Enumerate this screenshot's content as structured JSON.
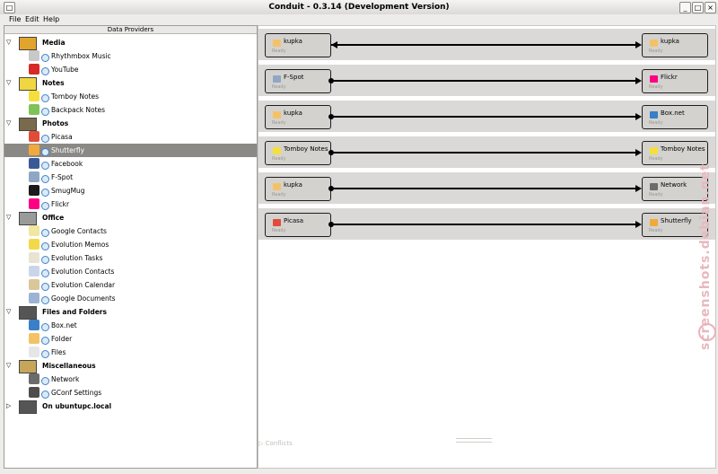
{
  "window": {
    "title": "Conduit - 0.3.14 (Development Version)"
  },
  "menu": [
    "File",
    "Edit",
    "Help"
  ],
  "left_panel": {
    "header": "Data Providers",
    "items": [
      {
        "kind": "category",
        "label": "Media",
        "icon": "media-icon",
        "color": "#e2a52b",
        "expanded": true
      },
      {
        "kind": "provider",
        "label": "Rhythmbox Music",
        "icon": "rhythmbox-icon",
        "color": "#c8c8c8"
      },
      {
        "kind": "provider",
        "label": "YouTube",
        "icon": "youtube-icon",
        "color": "#d72a25"
      },
      {
        "kind": "category",
        "label": "Notes",
        "icon": "notes-icon",
        "color": "#f0d640",
        "expanded": true
      },
      {
        "kind": "provider",
        "label": "Tomboy Notes",
        "icon": "tomboy-icon",
        "color": "#f5df3c"
      },
      {
        "kind": "provider",
        "label": "Backpack Notes",
        "icon": "backpack-icon",
        "color": "#7ec356"
      },
      {
        "kind": "category",
        "label": "Photos",
        "icon": "photos-icon",
        "color": "#7a6a4d",
        "expanded": true
      },
      {
        "kind": "provider",
        "label": "Picasa",
        "icon": "picasa-icon",
        "color": "#e14c3a"
      },
      {
        "kind": "provider",
        "label": "Shutterfly",
        "icon": "shutterfly-icon",
        "color": "#f2a93b",
        "selected": true
      },
      {
        "kind": "provider",
        "label": "Facebook",
        "icon": "facebook-icon",
        "color": "#3b5998"
      },
      {
        "kind": "provider",
        "label": "F-Spot",
        "icon": "fspot-icon",
        "color": "#8fa7c4"
      },
      {
        "kind": "provider",
        "label": "SmugMug",
        "icon": "smugmug-icon",
        "color": "#1a1a1a"
      },
      {
        "kind": "provider",
        "label": "Flickr",
        "icon": "flickr-icon",
        "color": "#ff0084"
      },
      {
        "kind": "category",
        "label": "Office",
        "icon": "office-icon",
        "color": "#9a9a9a",
        "expanded": true
      },
      {
        "kind": "provider",
        "label": "Google Contacts",
        "icon": "google-contacts-icon",
        "color": "#f1e6a2"
      },
      {
        "kind": "provider",
        "label": "Evolution Memos",
        "icon": "evolution-memos-icon",
        "color": "#f3d94a"
      },
      {
        "kind": "provider",
        "label": "Evolution Tasks",
        "icon": "evolution-tasks-icon",
        "color": "#e9e4d2"
      },
      {
        "kind": "provider",
        "label": "Evolution Contacts",
        "icon": "evolution-contacts-icon",
        "color": "#c9d6ea"
      },
      {
        "kind": "provider",
        "label": "Evolution Calendar",
        "icon": "evolution-calendar-icon",
        "color": "#d9c79a"
      },
      {
        "kind": "provider",
        "label": "Google Documents",
        "icon": "google-documents-icon",
        "color": "#9cb3d3"
      },
      {
        "kind": "category",
        "label": "Files and Folders",
        "icon": "computer-icon",
        "color": "#555555",
        "expanded": true
      },
      {
        "kind": "provider",
        "label": "Box.net",
        "icon": "boxnet-icon",
        "color": "#3a7fc7"
      },
      {
        "kind": "provider",
        "label": "Folder",
        "icon": "folder-icon",
        "color": "#f4c266"
      },
      {
        "kind": "provider",
        "label": "Files",
        "icon": "files-icon",
        "color": "#e6e6e6"
      },
      {
        "kind": "category",
        "label": "Miscellaneous",
        "icon": "misc-icon",
        "color": "#c7a65a",
        "expanded": true
      },
      {
        "kind": "provider",
        "label": "Network",
        "icon": "network-icon",
        "color": "#6b6b6b"
      },
      {
        "kind": "provider",
        "label": "GConf Settings",
        "icon": "gconf-icon",
        "color": "#4d4d4d"
      },
      {
        "kind": "category",
        "label": "On ubuntupc.local",
        "icon": "computer-icon",
        "color": "#555555",
        "expanded": false
      }
    ]
  },
  "canvas": {
    "conduits": [
      {
        "source": {
          "label": "kupka",
          "icon": "folder-icon",
          "color": "#f4c266",
          "status": "Ready"
        },
        "target": {
          "label": "kupka",
          "icon": "folder-icon",
          "color": "#f4c266",
          "status": "Ready"
        },
        "two_way": true
      },
      {
        "source": {
          "label": "F-Spot",
          "icon": "fspot-icon",
          "color": "#8fa7c4",
          "status": "Ready"
        },
        "target": {
          "label": "Flickr",
          "icon": "flickr-icon",
          "color": "#ff0084",
          "status": "Ready"
        },
        "two_way": false
      },
      {
        "source": {
          "label": "kupka",
          "icon": "folder-icon",
          "color": "#f4c266",
          "status": "Ready"
        },
        "target": {
          "label": "Box.net",
          "icon": "boxnet-icon",
          "color": "#3a7fc7",
          "status": "Ready"
        },
        "two_way": false
      },
      {
        "source": {
          "label": "Tomboy Notes",
          "icon": "tomboy-icon",
          "color": "#f5df3c",
          "status": "Ready"
        },
        "target": {
          "label": "Tomboy Notes",
          "icon": "tomboy-icon",
          "color": "#f5df3c",
          "status": "Ready"
        },
        "two_way": false
      },
      {
        "source": {
          "label": "kupka",
          "icon": "folder-icon",
          "color": "#f4c266",
          "status": "Ready"
        },
        "target": {
          "label": "Network",
          "icon": "network-icon",
          "color": "#6b6b6b",
          "status": "Ready"
        },
        "two_way": false
      },
      {
        "source": {
          "label": "Picasa",
          "icon": "picasa-icon",
          "color": "#e14c3a",
          "status": "Ready"
        },
        "target": {
          "label": "Shutterfly",
          "icon": "shutterfly-icon",
          "color": "#f2a93b",
          "status": "Ready"
        },
        "two_way": false
      }
    ],
    "conflicts_label": "Conflicts"
  },
  "watermark": "screenshots.debian.net"
}
